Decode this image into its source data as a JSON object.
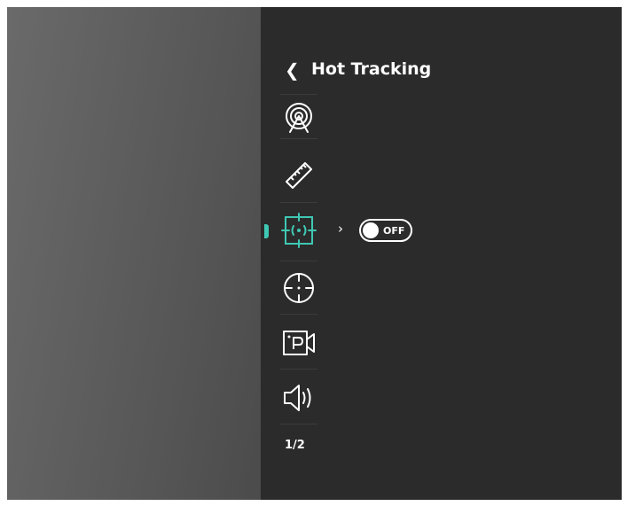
{
  "menu": {
    "title": "Hot Tracking",
    "items": [
      {
        "icon": "hotspot-radar-icon",
        "active": false
      },
      {
        "icon": "ruler-icon",
        "active": false
      },
      {
        "icon": "hot-tracking-icon",
        "active": true
      },
      {
        "icon": "reticle-icon",
        "active": false
      },
      {
        "icon": "pip-video-icon",
        "active": false
      },
      {
        "icon": "volume-icon",
        "active": false
      }
    ],
    "hot_tracking_toggle": {
      "state": "OFF"
    },
    "page_indicator": "1/2"
  },
  "colors": {
    "accent": "#3fc8b4",
    "panel_background": "#2b2b2b",
    "icon_stroke": "#ffffff"
  }
}
